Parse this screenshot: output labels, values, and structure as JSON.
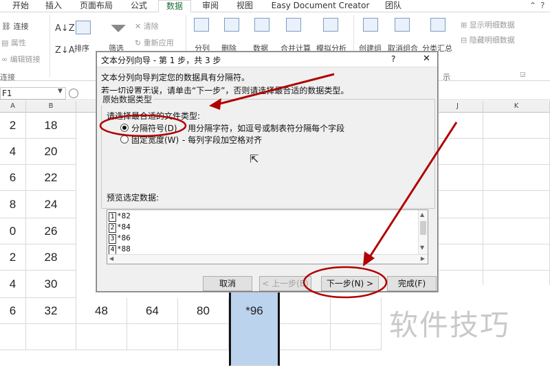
{
  "ribbon_tabs": [
    "开始",
    "插入",
    "页面布局",
    "公式",
    "数据",
    "审阅",
    "视图",
    "Easy Document Creator",
    "团队"
  ],
  "active_tab": "数据",
  "ribbon": {
    "connect": "连接",
    "properties": "属性",
    "edit_links": "编辑链接",
    "group_connections": "连接",
    "sort": "排序",
    "filter": "筛选",
    "clear": "清除",
    "reapply": "重新应用",
    "text_to_columns": "分列",
    "remove": "删除",
    "data": "数据",
    "consolidate": "合并计算",
    "whatif": "模拟分析",
    "group": "创建组",
    "ungroup": "取消组合",
    "subtotal": "分类汇总",
    "show_detail": "显示明细数据",
    "hide_detail": "隐藏明细数据",
    "group_outline": "示"
  },
  "namebox": "F1",
  "column_headers": [
    "A",
    "B",
    "J",
    "K"
  ],
  "rows": [
    {
      "a": "2",
      "b": "18"
    },
    {
      "a": "4",
      "b": "20"
    },
    {
      "a": "6",
      "b": "22"
    },
    {
      "a": "8",
      "b": "24"
    },
    {
      "a": "0",
      "b": "26"
    },
    {
      "a": "2",
      "b": "28"
    },
    {
      "a": "4",
      "b": "30"
    }
  ],
  "last_row": {
    "a": "6",
    "b": "32",
    "c": "48",
    "d": "64",
    "e": "80",
    "f": "*96"
  },
  "dialog": {
    "title": "文本分列向导 - 第 1 步，共 3 步",
    "help": "?",
    "close": "✕",
    "line1": "文本分列向导判定您的数据具有分隔符。",
    "line2": "若一切设置无误，请单击“下一步”，否则请选择最合适的数据类型。",
    "group_title": "原始数据类型",
    "group_prompt": "请选择最合适的文件类型:",
    "option1": "分隔符号(D)",
    "option1_desc": "- 用分隔字符，如逗号或制表符分隔每个字段",
    "option2": "固定宽度(W)",
    "option2_desc": "- 每列字段加空格对齐",
    "preview_label": "预览选定数据:",
    "preview_rows": [
      {
        "n": "1",
        "v": "*82"
      },
      {
        "n": "2",
        "v": "*84"
      },
      {
        "n": "3",
        "v": "*86"
      },
      {
        "n": "4",
        "v": "*88"
      }
    ],
    "btn_cancel": "取消",
    "btn_back": "< 上一步(B)",
    "btn_next": "下一步(N) >",
    "btn_finish": "完成(F)"
  },
  "watermark": "软件技巧",
  "colors": {
    "annotation": "#b00000",
    "selection": "#bcd3ee",
    "accent": "#1e6d3a"
  }
}
